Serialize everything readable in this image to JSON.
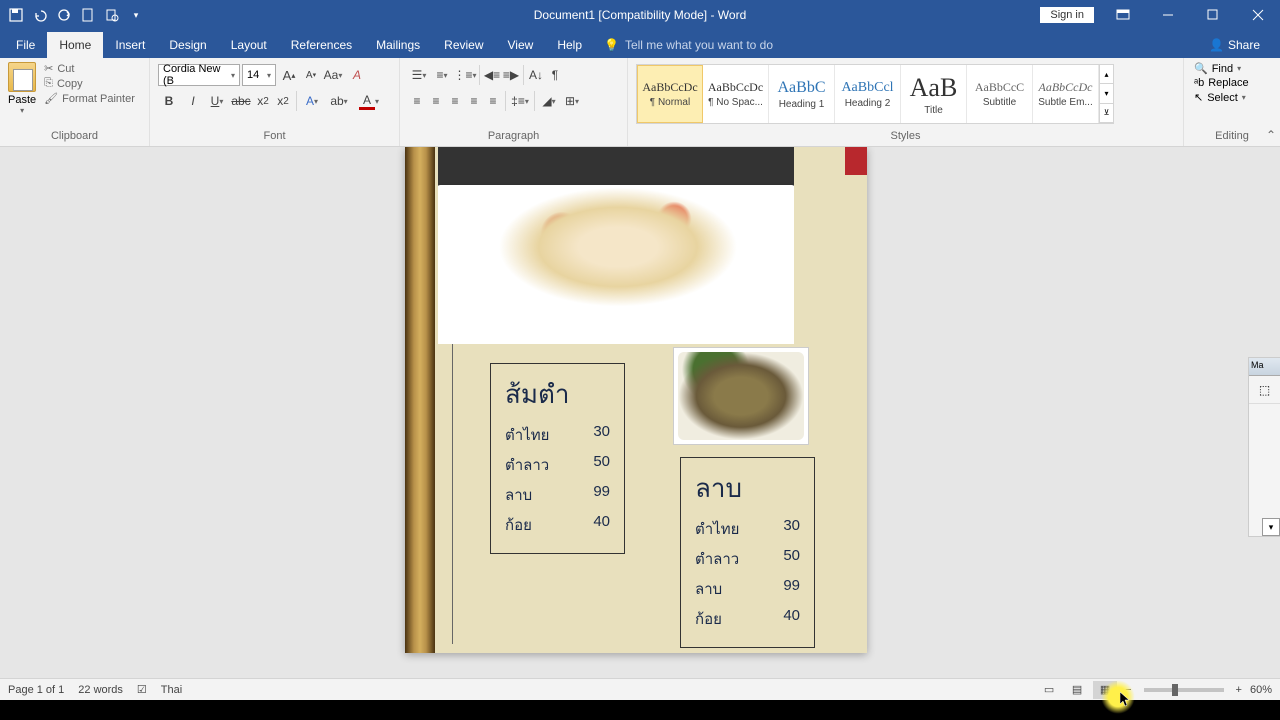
{
  "title": "Document1 [Compatibility Mode] - Word",
  "signin": "Sign in",
  "menus": {
    "file": "File",
    "home": "Home",
    "insert": "Insert",
    "design": "Design",
    "layout": "Layout",
    "references": "References",
    "mailings": "Mailings",
    "review": "Review",
    "view": "View",
    "help": "Help"
  },
  "tellme": "Tell me what you want to do",
  "share": "Share",
  "ribbon": {
    "clipboard": {
      "paste": "Paste",
      "cut": "Cut",
      "copy": "Copy",
      "formatpainter": "Format Painter",
      "label": "Clipboard"
    },
    "font": {
      "name": "Cordia New (B",
      "size": "14",
      "label": "Font"
    },
    "paragraph": {
      "label": "Paragraph"
    },
    "styles": {
      "label": "Styles",
      "items": [
        {
          "prev": "AaBbCcDc",
          "name": "¶ Normal",
          "cls": "n"
        },
        {
          "prev": "AaBbCcDc",
          "name": "¶ No Spac...",
          "cls": "n"
        },
        {
          "prev": "AaBbC",
          "name": "Heading 1",
          "cls": "h1"
        },
        {
          "prev": "AaBbCcl",
          "name": "Heading 2",
          "cls": "h2"
        },
        {
          "prev": "AaB",
          "name": "Title",
          "cls": "t"
        },
        {
          "prev": "AaBbCcC",
          "name": "Subtitle",
          "cls": "st"
        },
        {
          "prev": "AaBbCcDc",
          "name": "Subtle Em...",
          "cls": "se"
        }
      ]
    },
    "editing": {
      "find": "Find",
      "replace": "Replace",
      "select": "Select",
      "label": "Editing"
    }
  },
  "doc": {
    "box1": {
      "title": "ส้มตำ",
      "rows": [
        [
          "ตำไทย",
          "30"
        ],
        [
          "ตำลาว",
          "50"
        ],
        [
          "ลาบ",
          "99"
        ],
        [
          "ก้อย",
          "40"
        ]
      ]
    },
    "box2": {
      "title": "ลาบ",
      "rows": [
        [
          "ตำไทย",
          "30"
        ],
        [
          "ตำลาว",
          "50"
        ],
        [
          "ลาบ",
          "99"
        ],
        [
          "ก้อย",
          "40"
        ]
      ]
    }
  },
  "sidepanel": "Ma",
  "status": {
    "page": "Page 1 of 1",
    "words": "22 words",
    "lang": "Thai",
    "zoom": "60%"
  }
}
